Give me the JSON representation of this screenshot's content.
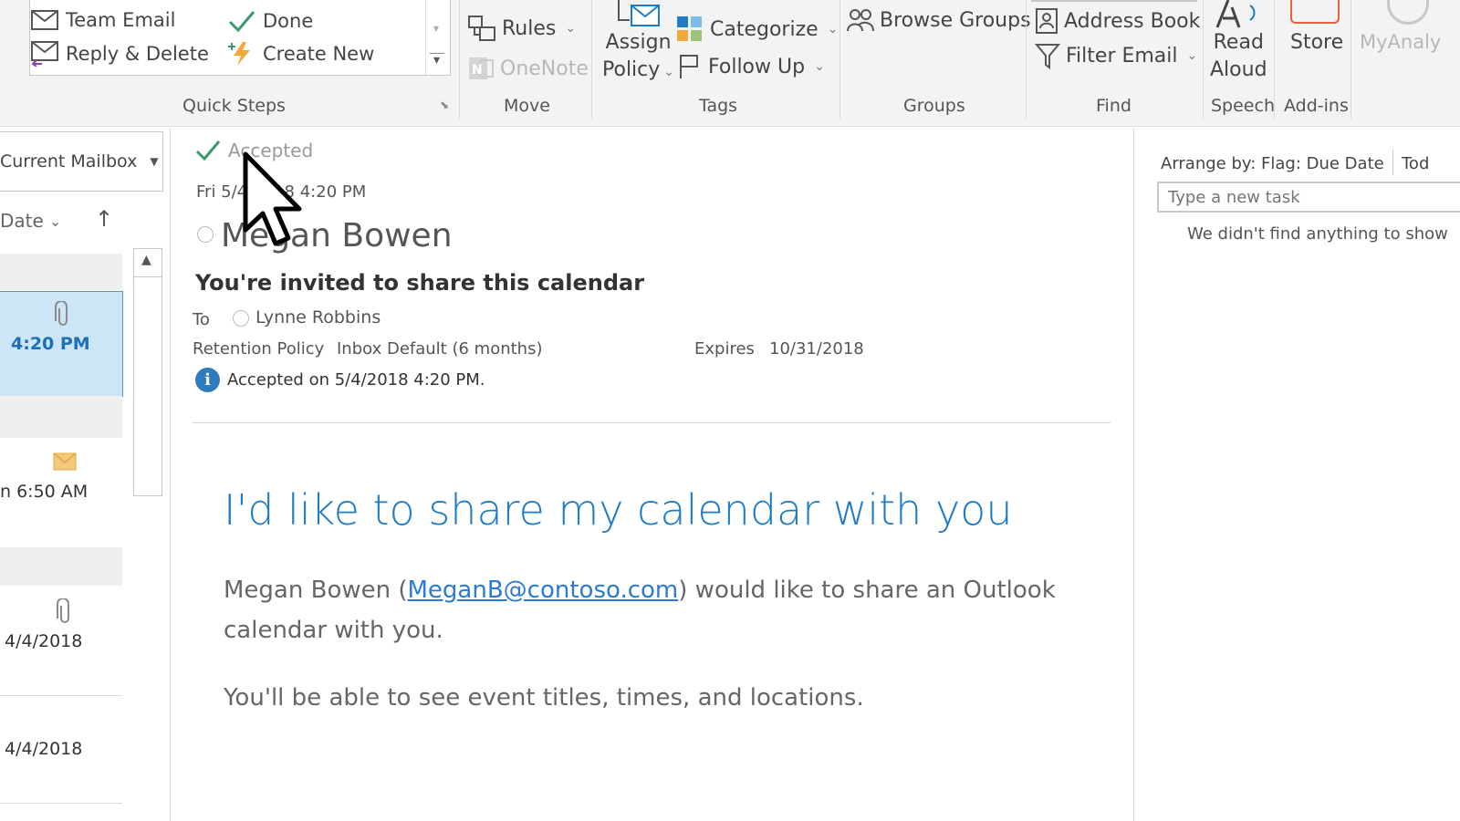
{
  "ribbon": {
    "quick_steps": {
      "team_email": "Team Email",
      "done": "Done",
      "reply_delete": "Reply & Delete",
      "create_new": "Create New",
      "group_label": "Quick Steps"
    },
    "move": {
      "rules": "Rules",
      "onenote": "OneNote",
      "group_label": "Move"
    },
    "assign_policy": {
      "line1": "Assign",
      "line2": "Policy"
    },
    "tags": {
      "categorize": "Categorize",
      "follow_up": "Follow Up",
      "group_label": "Tags"
    },
    "groups": {
      "browse_groups": "Browse Groups",
      "group_label": "Groups"
    },
    "find": {
      "address_book": "Address Book",
      "filter_email": "Filter Email",
      "group_label": "Find"
    },
    "speech": {
      "read_line1": "Read",
      "read_line2": "Aloud",
      "group_label": "Speech"
    },
    "addins": {
      "store": "Store",
      "group_label": "Add-ins"
    },
    "myanalytics": "MyAnaly"
  },
  "message_list": {
    "scope": "Current Mailbox",
    "sort_by": "Date",
    "items": [
      {
        "time": "4:20 PM"
      },
      {
        "time": "n 6:50 AM"
      },
      {
        "time": "4/4/2018"
      },
      {
        "time": "4/4/2018"
      }
    ]
  },
  "reading_pane": {
    "status": "Accepted",
    "date_sent": "Fri 5/4/2018 4:20 PM",
    "sender": "Megan Bowen",
    "subject": "You're invited to share this calendar",
    "to_label": "To",
    "recipient": "Lynne Robbins",
    "retention_label": "Retention Policy",
    "retention_value": "Inbox Default (6 months)",
    "expires_label": "Expires",
    "expires_value": "10/31/2018",
    "info": "Accepted on 5/4/2018 4:20 PM.",
    "body_heading": "I'd like to share my calendar with you",
    "body_p1_before": "Megan Bowen (",
    "body_email": "MeganB@contoso.com",
    "body_p1_after": ") would like to share an Outlook",
    "body_p1_line2": "calendar with you.",
    "body_p2": "You'll be able to see event titles, times, and locations."
  },
  "todo": {
    "arrange_by": "Arrange by: Flag: Due Date",
    "today": "Tod",
    "new_task_placeholder": "Type a new task",
    "empty_message": "We didn't find anything to show"
  },
  "colors": {
    "accent_blue": "#1e7bc6",
    "link_blue": "#2a7bd1",
    "selected_bg": "#cde6f7",
    "green_check": "#3a9a6e",
    "info_blue": "#2f7bbf"
  }
}
